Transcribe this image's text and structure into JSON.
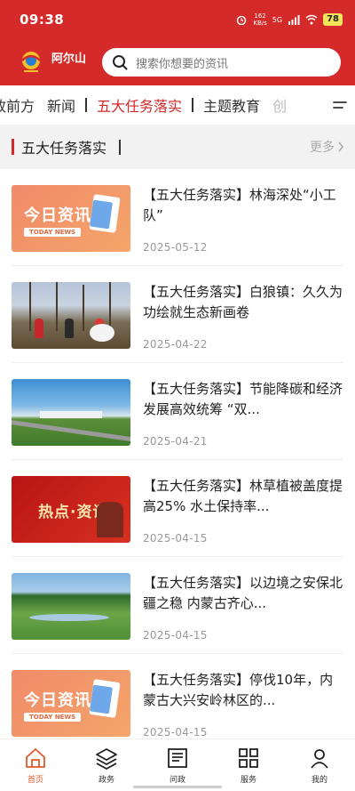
{
  "status_bar": {
    "time": "09:38",
    "net_speed_value": "162",
    "net_speed_unit": "KB/s",
    "signal_label": "5G",
    "battery": "78"
  },
  "header": {
    "brand": "阿尔山",
    "search_placeholder": "搜索你想要的资讯"
  },
  "tabs": [
    {
      "label": "政前方"
    },
    {
      "label": "新闻"
    },
    {
      "label": "五大任务落实",
      "active": true
    },
    {
      "label": "主题教育"
    },
    {
      "label": "创"
    }
  ],
  "section": {
    "title": "五大任务落实",
    "more_label": "更多"
  },
  "articles": [
    {
      "title": "【五大任务落实】林海深处“小工队”",
      "date": "2025-05-12",
      "thumb": "today-news",
      "thumb_title": "今日资讯",
      "thumb_sub": "TODAY NEWS"
    },
    {
      "title": "【五大任务落实】白狼镇：久久为功绘就生态新画卷",
      "date": "2025-04-22",
      "thumb": "forest-cleanup"
    },
    {
      "title": "【五大任务落实】节能降碳和经济发展高效统筹 “双...",
      "date": "2025-04-21",
      "thumb": "factory-aerial"
    },
    {
      "title": "【五大任务落实】林草植被盖度提高25% 水土保持率...",
      "date": "2025-04-15",
      "thumb": "hot-news",
      "thumb_title": "热点·资讯"
    },
    {
      "title": "【五大任务落实】以边境之安保北疆之稳 内蒙古齐心...",
      "date": "2025-04-15",
      "thumb": "grassland"
    },
    {
      "title": "【五大任务落实】停伐10年，内蒙古大兴安岭林区的...",
      "date": "2025-04-15",
      "thumb": "today-news",
      "thumb_title": "今日资讯",
      "thumb_sub": "TODAY NEWS"
    }
  ],
  "bottom_nav": [
    {
      "label": "首页",
      "icon": "home-icon",
      "active": true
    },
    {
      "label": "政务",
      "icon": "layers-icon"
    },
    {
      "label": "问政",
      "icon": "document-icon"
    },
    {
      "label": "服务",
      "icon": "grid-icon"
    },
    {
      "label": "我的",
      "icon": "person-icon"
    }
  ],
  "colors": {
    "brand_red": "#d42a2a",
    "nav_active": "#e5582a"
  }
}
